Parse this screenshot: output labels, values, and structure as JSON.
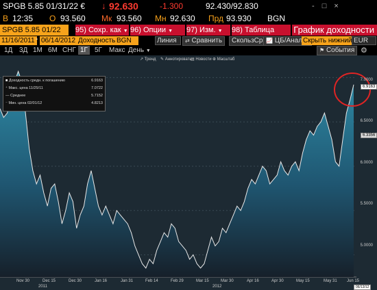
{
  "quote": {
    "ticker": "SPGB 5.85 01/31/22 €",
    "last_arrow": "↓",
    "last": "92.630",
    "change": "-1.300",
    "bid_ask": "92.430/92.830",
    "window_controls": "- □ ×",
    "line2_a_label": "В",
    "line2_time": "12:35",
    "line2_o_label": "О",
    "line2_open": "93.560",
    "line2_high_label": "Мк",
    "line2_high": "93.560",
    "line2_low_label": "Мн",
    "line2_low": "92.630",
    "line2_prev_label": "Прд",
    "line2_prev": "93.930",
    "line2_source": "BGN"
  },
  "toolbar": {
    "security_button": "SPGB 5.85 01/22",
    "menu_save": {
      "num": "95)",
      "label": "Сохр. как"
    },
    "menu_options": {
      "num": "96)",
      "label": "Опции"
    },
    "menu_edit": {
      "num": "97)",
      "label": "Изм."
    },
    "menu_table": {
      "num": "98)",
      "label": "Таблица"
    },
    "title": "График доходности"
  },
  "controls": {
    "date_from": "11/16/2011",
    "date_to": "06/14/2012",
    "field": "Доходность",
    "source": "BGN",
    "line_type": "Линия",
    "compare": "Сравнить",
    "moving_avg": "СкользСр",
    "events_analysis": "ЦБ/Анализ",
    "hide_lower": "Скрыть нижний",
    "events": "События",
    "currency": "EUR"
  },
  "periods": [
    "1Д",
    "3Д",
    "1М",
    "6М",
    "СНГ",
    "1Г",
    "5Г",
    "Макс"
  ],
  "selected_period": "1Г",
  "interval": "День",
  "chart_tools": [
    "Тренд",
    "Аннотировать",
    "Новости",
    "Масштаб"
  ],
  "legend": [
    {
      "label": "Доходность средн. к погашению",
      "value": "6.9163"
    },
    {
      "label": "Макс. цена 11/25/11",
      "value": "7.0722"
    },
    {
      "label": "Среднее",
      "value": "5.7152"
    },
    {
      "label": "Мин. цена 02/01/12",
      "value": "4.8213"
    }
  ],
  "chart_data": {
    "type": "area",
    "y_ticks": [
      "7.0000",
      "6.5000",
      "6.0000",
      "5.5000",
      "5.0000"
    ],
    "ylim": [
      4.75,
      7.25
    ],
    "flag_last": "6.9163",
    "flag_avg": "6.3356",
    "x_ticks": [
      "Nov 30",
      "Dec 15",
      "Dec 30",
      "Jan 16",
      "Jan 31",
      "Feb 14",
      "Feb 29",
      "Mar 15",
      "Mar 30",
      "Apr 16",
      "Apr 30",
      "May 15",
      "May 31",
      "Jun 15"
    ],
    "x_years": [
      "2011",
      "2012"
    ],
    "last_date": "06/13/12",
    "values": [
      6.65,
      6.55,
      6.6,
      6.8,
      6.95,
      7.07,
      6.95,
      6.6,
      6.2,
      5.95,
      5.8,
      5.9,
      5.7,
      5.55,
      5.75,
      5.8,
      5.6,
      5.35,
      5.5,
      5.7,
      5.6,
      5.3,
      5.45,
      5.55,
      5.8,
      5.95,
      5.75,
      5.55,
      5.45,
      5.55,
      5.45,
      5.35,
      5.5,
      5.45,
      5.4,
      5.35,
      5.25,
      5.1,
      5.0,
      4.9,
      4.85,
      4.95,
      4.9,
      5.05,
      5.15,
      5.25,
      5.2,
      5.35,
      5.3,
      5.15,
      5.1,
      5.05,
      4.95,
      5.0,
      4.9,
      4.85,
      4.9,
      5.05,
      5.2,
      5.1,
      5.15,
      5.3,
      5.25,
      5.35,
      5.45,
      5.55,
      5.5,
      5.6,
      5.75,
      5.85,
      5.8,
      5.9,
      6.0,
      5.95,
      5.8,
      5.85,
      5.9,
      6.05,
      5.95,
      5.9,
      6.0,
      6.05,
      5.95,
      6.15,
      6.3,
      6.4,
      6.35,
      6.45,
      6.5,
      6.6,
      6.45,
      6.3,
      6.05,
      6.0,
      6.3,
      6.6,
      6.75,
      6.92
    ]
  }
}
